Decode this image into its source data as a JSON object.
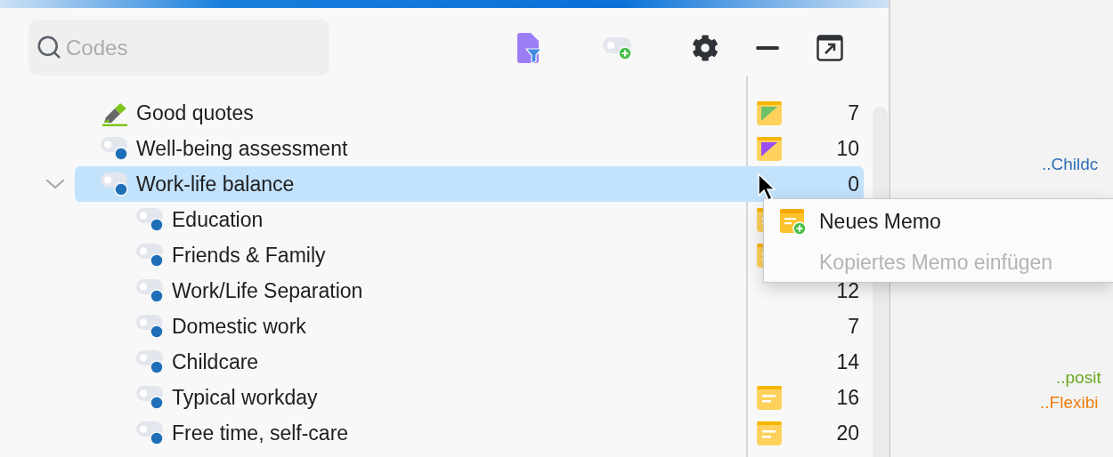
{
  "search": {
    "placeholder": "Codes"
  },
  "tree": {
    "items": [
      {
        "label": "Good quotes",
        "kind": "highlighter",
        "count": "7",
        "memo": {
          "kind": "corner",
          "color": "#6cc16b"
        },
        "selected": false
      },
      {
        "label": "Well-being assessment",
        "kind": "code",
        "count": "10",
        "memo": {
          "kind": "corner",
          "color": "#9b4cf0"
        },
        "selected": false
      },
      {
        "label": "Work-life balance",
        "kind": "code",
        "count": "0",
        "selected": true,
        "expanded": true,
        "children": [
          {
            "label": "Education",
            "kind": "code",
            "memo": {
              "kind": "plain"
            },
            "selected": false
          },
          {
            "label": "Friends & Family",
            "kind": "code",
            "memo": {
              "kind": "plain"
            },
            "selected": false
          },
          {
            "label": "Work/Life Separation",
            "kind": "code",
            "count": "12",
            "selected": false
          },
          {
            "label": "Domestic work",
            "kind": "code",
            "count": "7",
            "selected": false
          },
          {
            "label": "Childcare",
            "kind": "code",
            "count": "14",
            "selected": false
          },
          {
            "label": "Typical workday",
            "kind": "code",
            "count": "16",
            "memo": {
              "kind": "plain"
            },
            "selected": false
          },
          {
            "label": "Free time, self-care",
            "kind": "code",
            "count": "20",
            "memo": {
              "kind": "plain"
            },
            "selected": false
          }
        ]
      }
    ]
  },
  "context_menu": {
    "items": [
      {
        "label": "Neues Memo",
        "kind": "memo-add",
        "disabled": false
      },
      {
        "label": "Kopiertes Memo einfügen",
        "kind": "plain",
        "disabled": true
      }
    ]
  },
  "preview": {
    "snippets": [
      {
        "text": "..Childc",
        "color": "#2f6fb5"
      },
      {
        "text": "..posit",
        "color": "#6aa81e"
      },
      {
        "text": "..Flexibi",
        "color": "#ee7d0e"
      }
    ]
  }
}
